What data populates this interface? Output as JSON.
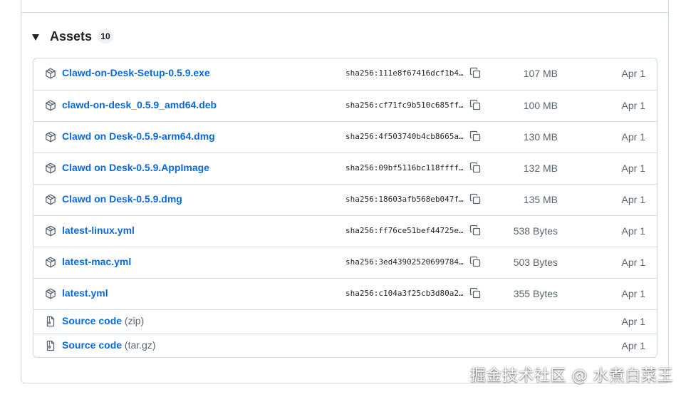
{
  "assets": {
    "title": "Assets",
    "count": "10",
    "items": [
      {
        "kind": "package-icon",
        "name": "Clawd-on-Desk-Setup-0.5.9.exe",
        "hash": "sha256:111e8f67416dcf1b4…",
        "size": "107 MB",
        "date": "Apr 1"
      },
      {
        "kind": "package-icon",
        "name": "clawd-on-desk_0.5.9_amd64.deb",
        "hash": "sha256:cf71fc9b510c685ff…",
        "size": "100 MB",
        "date": "Apr 1"
      },
      {
        "kind": "package-icon",
        "name": "Clawd on Desk-0.5.9-arm64.dmg",
        "hash": "sha256:4f503740b4cb8665a…",
        "size": "130 MB",
        "date": "Apr 1"
      },
      {
        "kind": "package-icon",
        "name": "Clawd on Desk-0.5.9.AppImage",
        "hash": "sha256:09bf5116bc118ffff…",
        "size": "132 MB",
        "date": "Apr 1"
      },
      {
        "kind": "package-icon",
        "name": "Clawd on Desk-0.5.9.dmg",
        "hash": "sha256:18603afb568eb047f…",
        "size": "135 MB",
        "date": "Apr 1"
      },
      {
        "kind": "package-icon",
        "name": "latest-linux.yml",
        "hash": "sha256:ff76ce51bef44725e…",
        "size": "538 Bytes",
        "date": "Apr 1"
      },
      {
        "kind": "package-icon",
        "name": "latest-mac.yml",
        "hash": "sha256:3ed43902520699784…",
        "size": "503 Bytes",
        "date": "Apr 1"
      },
      {
        "kind": "package-icon",
        "name": "latest.yml",
        "hash": "sha256:c104a3f25cb3d80a2…",
        "size": "355 Bytes",
        "date": "Apr 1"
      },
      {
        "kind": "file-zip-icon",
        "name": "Source code",
        "suffix": "(zip)",
        "date": "Apr 1"
      },
      {
        "kind": "file-zip-icon",
        "name": "Source code",
        "suffix": "(tar.gz)",
        "date": "Apr 1"
      }
    ]
  },
  "watermark": "掘金技术社区 @ 水煮白菜王",
  "colors": {
    "link": "#0969da",
    "muted": "#59636e",
    "border": "#d1d9e0",
    "text": "#1f2328"
  }
}
